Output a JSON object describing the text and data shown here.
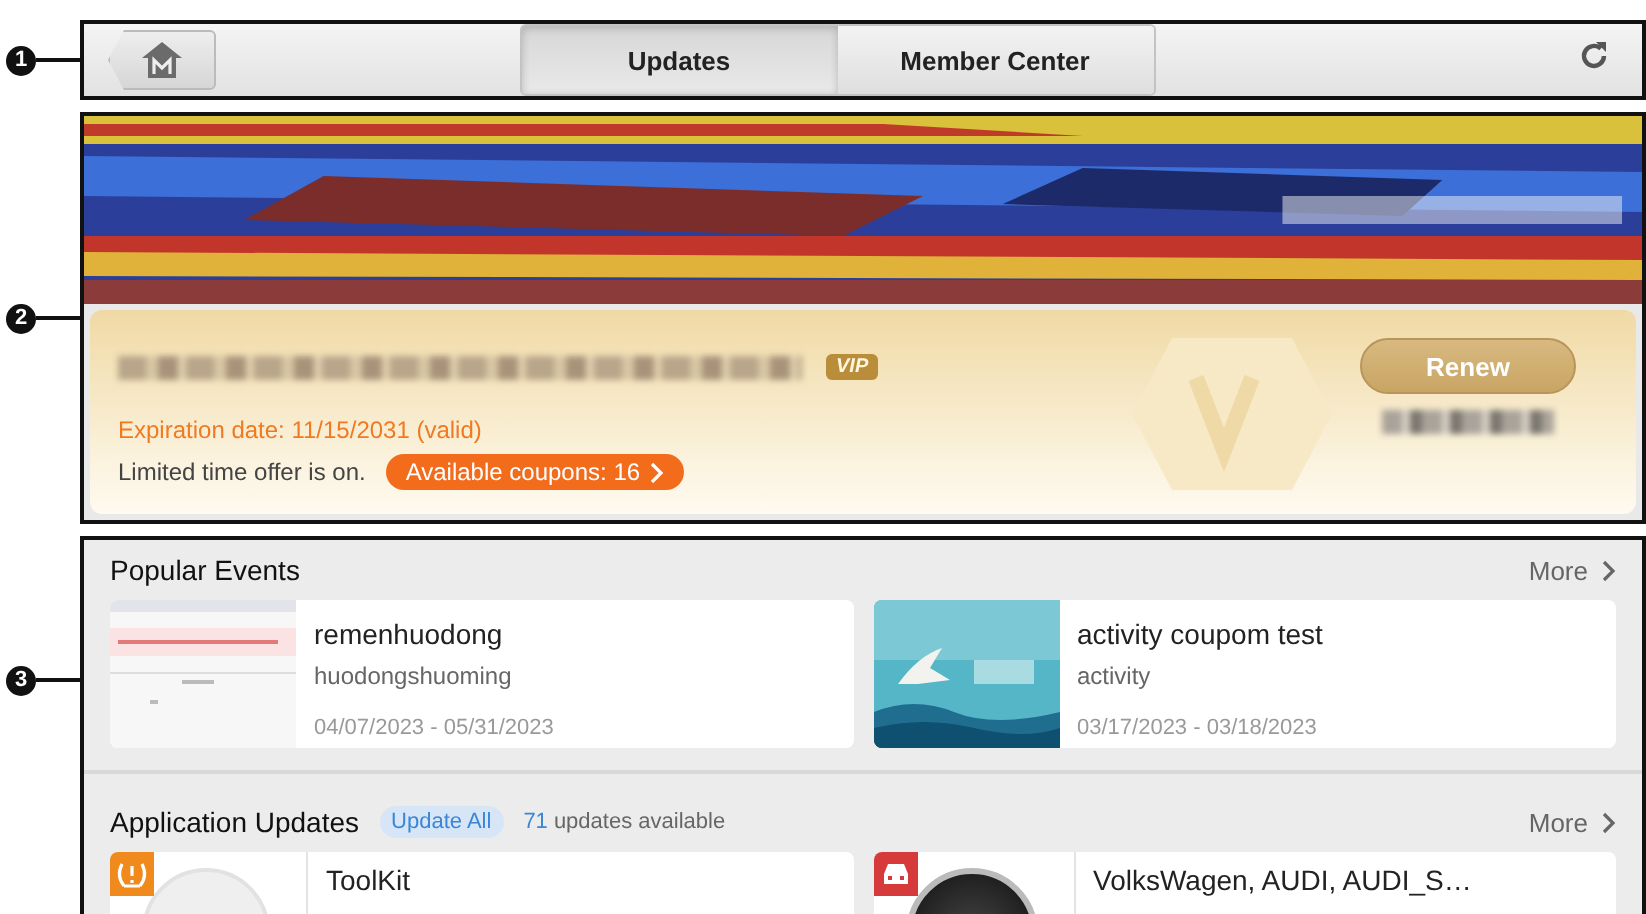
{
  "callouts": [
    "1",
    "2",
    "3"
  ],
  "toolbar": {
    "tabs": [
      {
        "label": "Updates",
        "selected": true
      },
      {
        "label": "Member Center",
        "selected": false
      }
    ]
  },
  "membership": {
    "badge": "VIP",
    "expiration": "Expiration date: 11/15/2031  (valid)",
    "offer": "Limited time offer is on.",
    "coupons": "Available coupons:  16",
    "button": "Renew"
  },
  "popular_events": {
    "title": "Popular Events",
    "more": "More",
    "events": [
      {
        "title": "remenhuodong",
        "subtitle": "huodongshuoming",
        "dates": "04/07/2023 - 05/31/2023"
      },
      {
        "title": "activity coupom test",
        "subtitle": "activity",
        "dates": "03/17/2023 - 03/18/2023"
      }
    ]
  },
  "app_updates": {
    "title": "Application Updates",
    "update_all": "Update All",
    "count": "71",
    "count_label": "updates available",
    "more": "More",
    "apps": [
      {
        "name": "ToolKit",
        "kind": "tool"
      },
      {
        "name": "VolksWagen,  AUDI,  AUDI_S…",
        "kind": "car"
      }
    ]
  }
}
